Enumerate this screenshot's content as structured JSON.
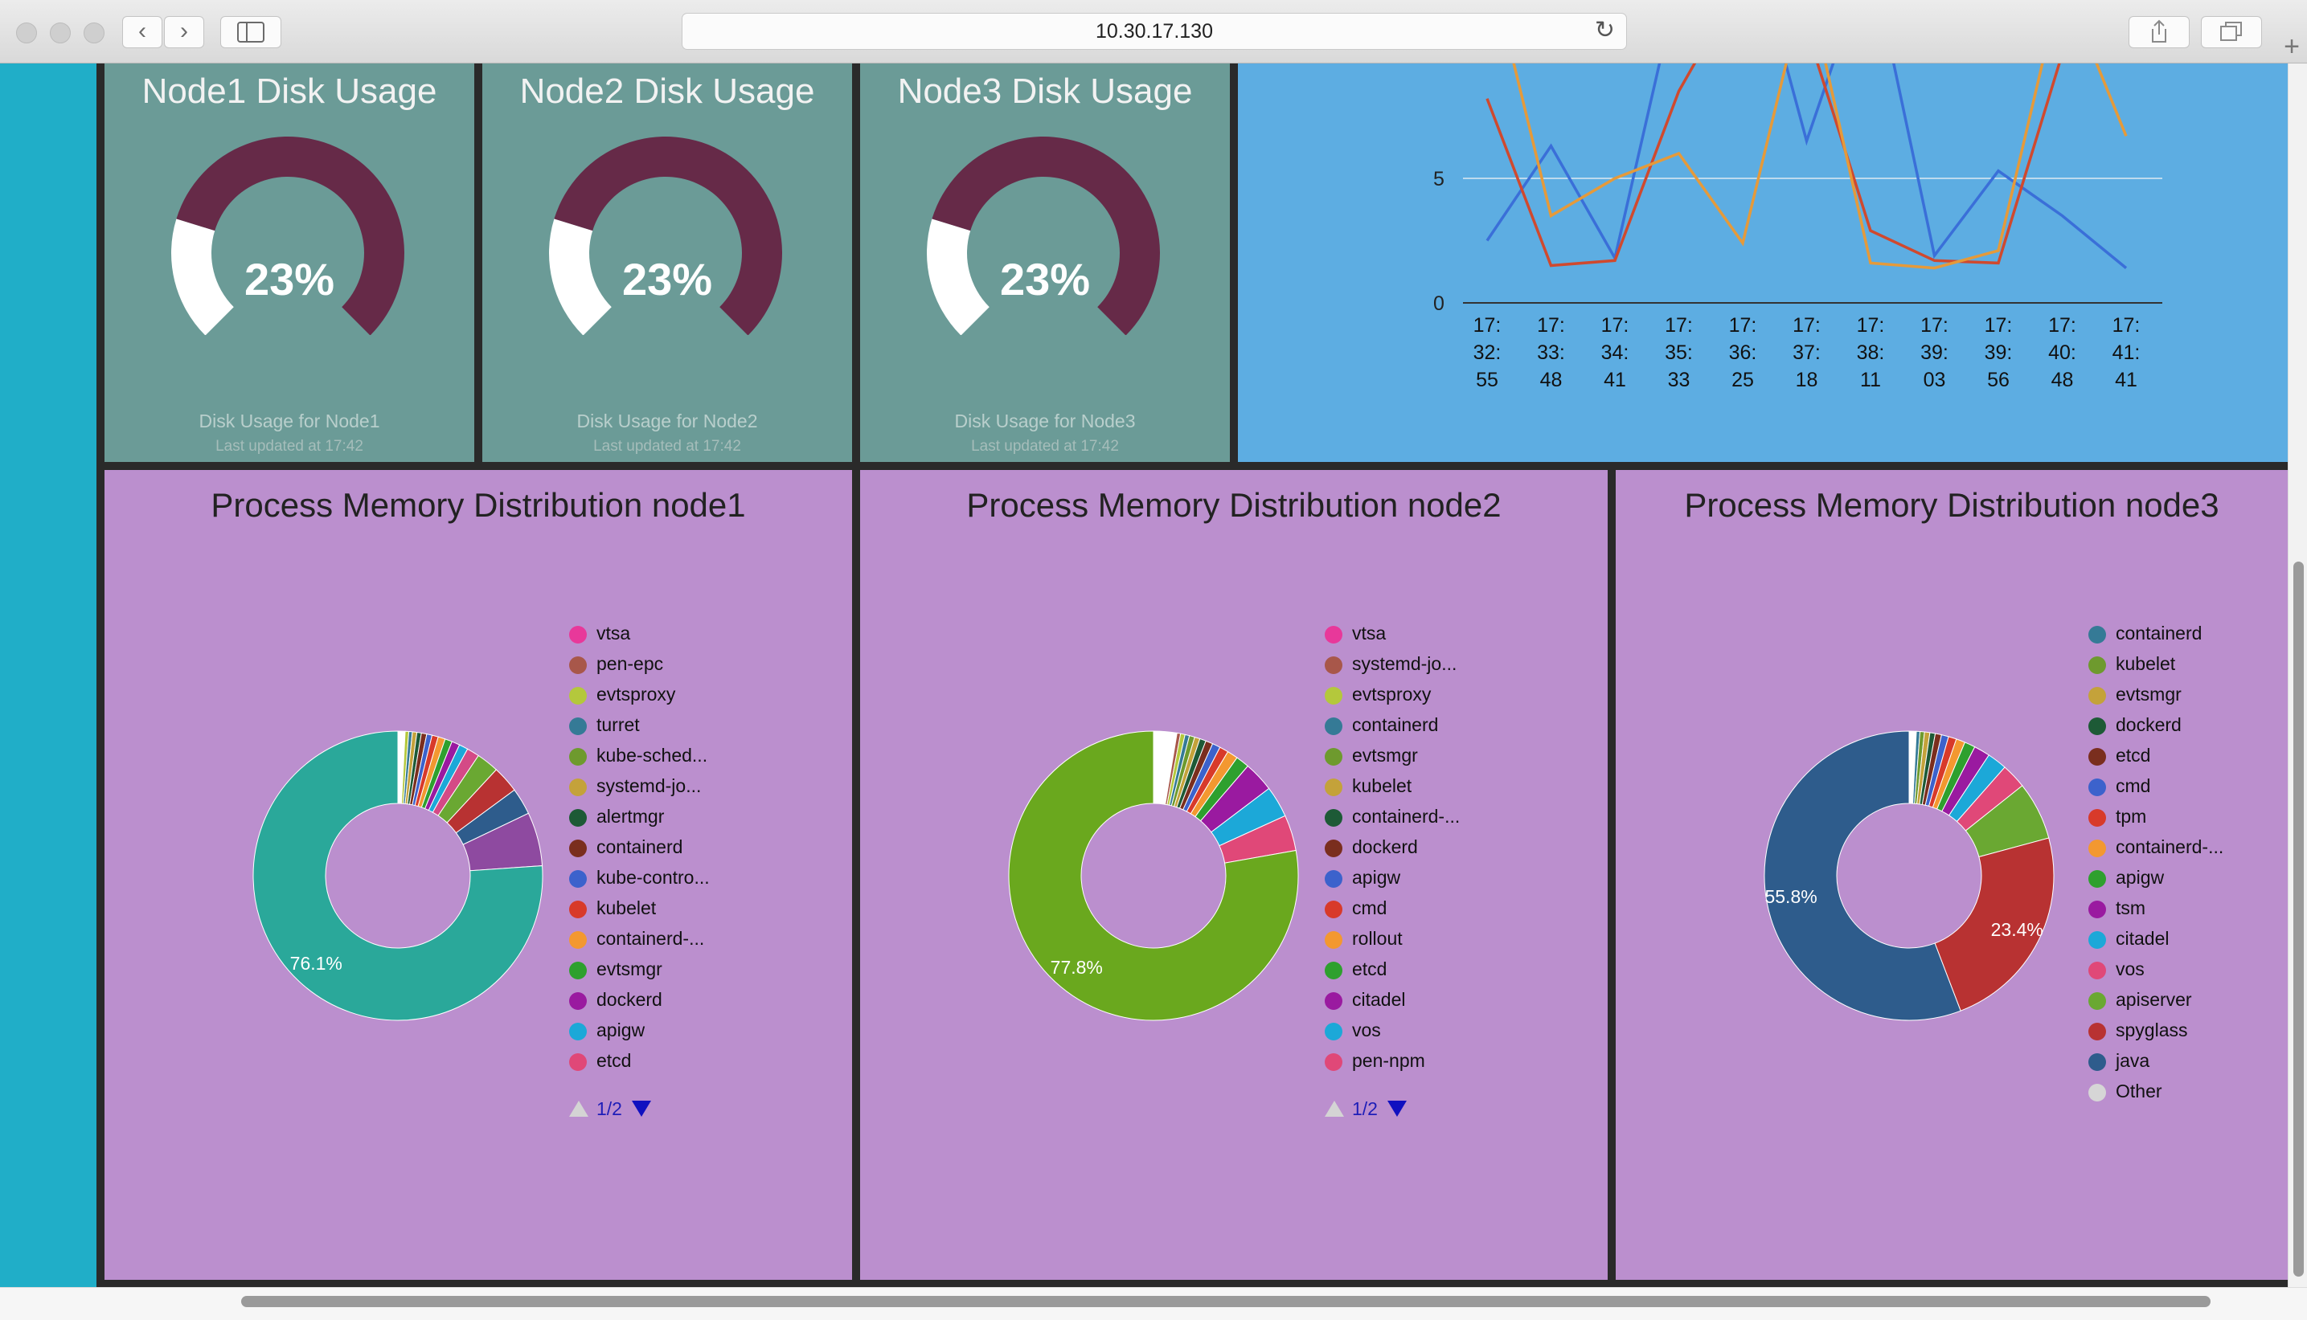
{
  "browser": {
    "url": "10.30.17.130",
    "back_glyph": "‹",
    "forward_glyph": "›",
    "reload_glyph": "↻",
    "new_tab_glyph": "+"
  },
  "gauges": [
    {
      "title": "Node1 Disk Usage",
      "value": "23%",
      "fraction": 0.23,
      "subtitle": "Disk Usage for Node1",
      "updated": "Last updated at 17:42"
    },
    {
      "title": "Node2 Disk Usage",
      "value": "23%",
      "fraction": 0.23,
      "subtitle": "Disk Usage for Node2",
      "updated": "Last updated at 17:42"
    },
    {
      "title": "Node3 Disk Usage",
      "value": "23%",
      "fraction": 0.23,
      "subtitle": "Disk Usage for Node3",
      "updated": "Last updated at 17:42"
    }
  ],
  "colors": {
    "gauge_bg": "#6b9b97",
    "gauge_used": "#662a48",
    "gauge_free": "#ffffff",
    "line_bg": "#5dade2",
    "pie_bg": "#bb8fce",
    "left_bar": "#20aec8"
  },
  "chart_data": [
    {
      "type": "line",
      "title": "",
      "xlabel": "",
      "ylabel": "",
      "ytick_labels": [
        "0",
        "5"
      ],
      "ylim": [
        0,
        12
      ],
      "grid": true,
      "x": [
        "17:32:55",
        "17:33:48",
        "17:34:41",
        "17:35:33",
        "17:36:25",
        "17:37:18",
        "17:38:11",
        "17:39:03",
        "17:39:56",
        "17:40:48",
        "17:41:41"
      ],
      "series": [
        {
          "color": "#3a6fd8",
          "values": [
            2.5,
            6.3,
            1.8,
            13,
            16,
            6.5,
            14,
            1.9,
            5.3,
            3.5,
            1.4
          ]
        },
        {
          "color": "#d0492e",
          "values": [
            8.2,
            1.5,
            1.7,
            8.5,
            13,
            11,
            2.9,
            1.7,
            1.6,
            10,
            15
          ]
        },
        {
          "color": "#e59a3a",
          "values": [
            14,
            3.5,
            5.0,
            6.0,
            2.4,
            13,
            1.6,
            1.4,
            2.1,
            13,
            6.7
          ]
        }
      ]
    },
    {
      "type": "pie",
      "title": "Process Memory Distribution node1",
      "labels": [
        "vtsa",
        "pen-epc",
        "evtsproxy",
        "turret",
        "kube-sched...",
        "systemd-jo...",
        "alertmgr",
        "containerd",
        "kube-contro...",
        "kubelet",
        "containerd-...",
        "evtsmgr",
        "dockerd",
        "apigw",
        "etcd"
      ],
      "legend_colors": [
        "#e8389a",
        "#a8574a",
        "#b4c83c",
        "#357a96",
        "#6e9a2e",
        "#c4a23a",
        "#1d5a36",
        "#7a2e1e",
        "#3c62cc",
        "#d83a2a",
        "#f39830",
        "#2ea02e",
        "#9a1aa0",
        "#1ca8d8",
        "#e04878"
      ],
      "slices": [
        {
          "color": "#2aa89a",
          "value": 76.1
        },
        {
          "color": "#8e4aa0",
          "value": 6.0
        },
        {
          "color": "#2e5c8c",
          "value": 3.0
        },
        {
          "color": "#b83232",
          "value": 3.0
        },
        {
          "color": "#6aa832",
          "value": 2.5
        },
        {
          "color": "#d44a86",
          "value": 1.4
        },
        {
          "color": "#1ca8d8",
          "value": 1.0
        },
        {
          "color": "#9a1aa0",
          "value": 0.9
        },
        {
          "color": "#2ea02e",
          "value": 0.8
        },
        {
          "color": "#f39830",
          "value": 0.8
        },
        {
          "color": "#d83a2a",
          "value": 0.7
        },
        {
          "color": "#3c62cc",
          "value": 0.6
        },
        {
          "color": "#7a2e1e",
          "value": 0.6
        },
        {
          "color": "#1d5a36",
          "value": 0.5
        },
        {
          "color": "#c4a23a",
          "value": 0.5
        },
        {
          "color": "#357a96",
          "value": 0.4
        },
        {
          "color": "#b4c83c",
          "value": 0.4
        },
        {
          "color": "#ffffff",
          "value": 0.8
        }
      ],
      "center_label": "76.1%",
      "pager": "1/2"
    },
    {
      "type": "pie",
      "title": "Process Memory Distribution node2",
      "labels": [
        "vtsa",
        "systemd-jo...",
        "evtsproxy",
        "containerd",
        "evtsmgr",
        "kubelet",
        "containerd-...",
        "dockerd",
        "apigw",
        "cmd",
        "rollout",
        "etcd",
        "citadel",
        "vos",
        "pen-npm"
      ],
      "legend_colors": [
        "#e8389a",
        "#a8574a",
        "#b4c83c",
        "#357a96",
        "#6e9a2e",
        "#c4a23a",
        "#1d5a36",
        "#7a2e1e",
        "#3c62cc",
        "#d83a2a",
        "#f39830",
        "#2ea02e",
        "#9a1aa0",
        "#1ca8d8",
        "#e04878"
      ],
      "slices": [
        {
          "color": "#6aa81e",
          "value": 77.8
        },
        {
          "color": "#e04878",
          "value": 4.0
        },
        {
          "color": "#1ca8d8",
          "value": 3.5
        },
        {
          "color": "#9a1aa0",
          "value": 3.4
        },
        {
          "color": "#2ea02e",
          "value": 1.5
        },
        {
          "color": "#f39830",
          "value": 1.2
        },
        {
          "color": "#d83a2a",
          "value": 1.0
        },
        {
          "color": "#3c62cc",
          "value": 0.9
        },
        {
          "color": "#7a2e1e",
          "value": 0.8
        },
        {
          "color": "#1d5a36",
          "value": 0.7
        },
        {
          "color": "#c4a23a",
          "value": 0.6
        },
        {
          "color": "#6e9a2e",
          "value": 0.6
        },
        {
          "color": "#357a96",
          "value": 0.5
        },
        {
          "color": "#b4c83c",
          "value": 0.5
        },
        {
          "color": "#a8574a",
          "value": 0.4
        },
        {
          "color": "#ffffff",
          "value": 2.6
        }
      ],
      "center_label": "77.8%",
      "pager": "1/2"
    },
    {
      "type": "pie",
      "title": "Process Memory Distribution node3",
      "labels": [
        "containerd",
        "kubelet",
        "evtsmgr",
        "dockerd",
        "etcd",
        "cmd",
        "tpm",
        "containerd-...",
        "apigw",
        "tsm",
        "citadel",
        "vos",
        "apiserver",
        "spyglass",
        "java",
        "Other"
      ],
      "legend_colors": [
        "#357a96",
        "#6e9a2e",
        "#c4a23a",
        "#1d5a36",
        "#7a2e1e",
        "#3c62cc",
        "#d83a2a",
        "#f39830",
        "#2ea02e",
        "#9a1aa0",
        "#1ca8d8",
        "#e04878",
        "#6aa832",
        "#b83232",
        "#2e5c8c",
        "#d6d6d6"
      ],
      "slices": [
        {
          "color": "#2e5c8c",
          "value": 55.8
        },
        {
          "color": "#b83232",
          "value": 23.4
        },
        {
          "color": "#6aa832",
          "value": 6.5
        },
        {
          "color": "#e04878",
          "value": 2.8
        },
        {
          "color": "#1ca8d8",
          "value": 2.2
        },
        {
          "color": "#9a1aa0",
          "value": 1.8
        },
        {
          "color": "#2ea02e",
          "value": 1.2
        },
        {
          "color": "#f39830",
          "value": 1.0
        },
        {
          "color": "#d83a2a",
          "value": 0.9
        },
        {
          "color": "#3c62cc",
          "value": 0.8
        },
        {
          "color": "#7a2e1e",
          "value": 0.7
        },
        {
          "color": "#1d5a36",
          "value": 0.6
        },
        {
          "color": "#c4a23a",
          "value": 0.6
        },
        {
          "color": "#6e9a2e",
          "value": 0.5
        },
        {
          "color": "#357a96",
          "value": 0.4
        },
        {
          "color": "#ffffff",
          "value": 0.8
        }
      ],
      "center_label": "55.8%",
      "second_label": "23.4%"
    }
  ]
}
